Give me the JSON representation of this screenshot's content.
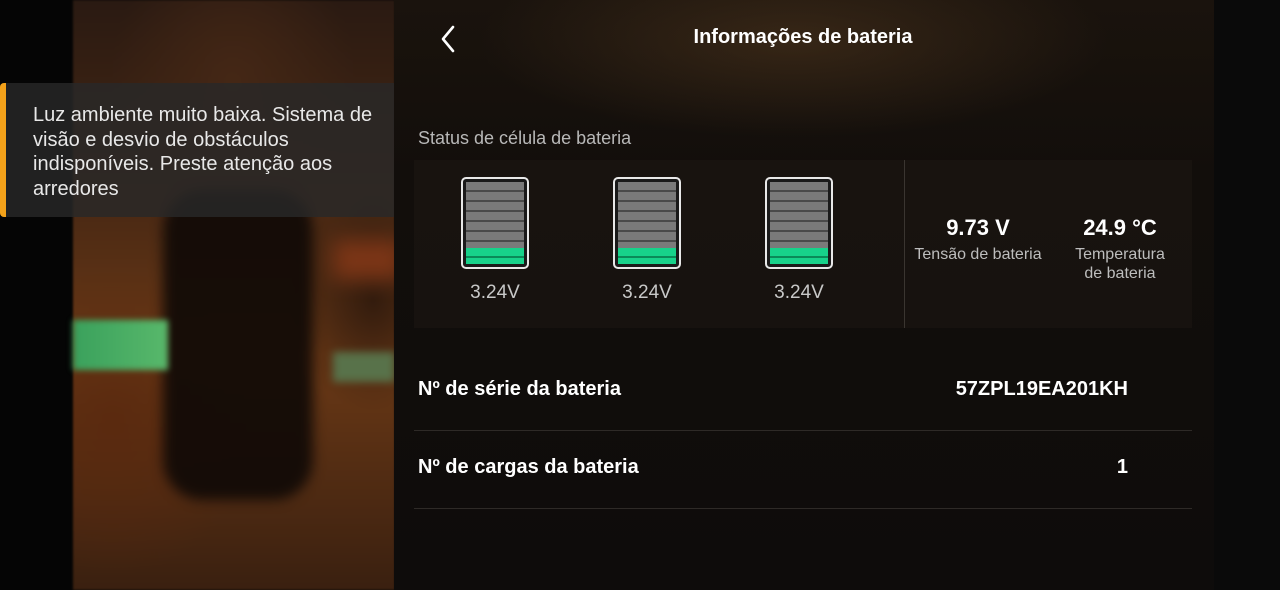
{
  "warning": {
    "text": "Luz ambiente muito baixa. Sistema de visão e desvio de obstáculos indisponíveis. Preste atenção aos arredores",
    "accent_color": "#f4a21a"
  },
  "header": {
    "back_icon": "chevron-left-icon",
    "title": "Informações de bateria"
  },
  "cells_section": {
    "label": "Status de célula de bateria",
    "cells": [
      {
        "voltage": "3.24V",
        "level": 0.2
      },
      {
        "voltage": "3.24V",
        "level": 0.2
      },
      {
        "voltage": "3.24V",
        "level": 0.2
      }
    ],
    "fill_color": "#17d28a"
  },
  "stats": {
    "voltage": {
      "value": "9.73 V",
      "label": "Tensão de bateria"
    },
    "temperature": {
      "value": "24.9 °C",
      "label_line1": "Temperatura",
      "label_line2": "de bateria"
    }
  },
  "rows": {
    "serial": {
      "label": "Nº de série da bateria",
      "value": "57ZPL19EA201KH"
    },
    "charges": {
      "label": "Nº de cargas da bateria",
      "value": "1"
    }
  }
}
